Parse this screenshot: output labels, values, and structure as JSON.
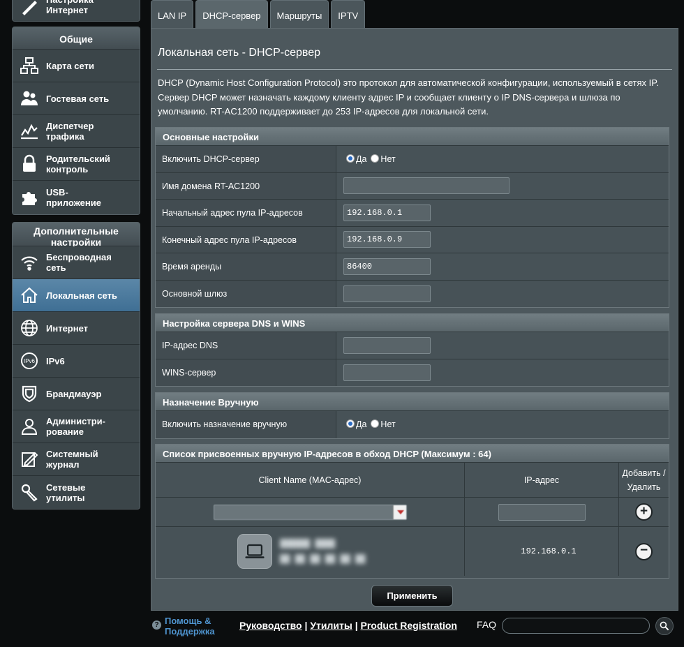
{
  "sidebar": {
    "top_item": "Настройка\nИнтернет",
    "general": {
      "title": "Общие",
      "items": [
        {
          "label": "Карта сети",
          "icon": "network-map-icon"
        },
        {
          "label": "Гостевая сеть",
          "icon": "guest-network-icon"
        },
        {
          "label": "Диспетчер\nтрафика",
          "icon": "traffic-manager-icon"
        },
        {
          "label": "Родительский\nконтроль",
          "icon": "lock-icon"
        },
        {
          "label": "USB-\nприложение",
          "icon": "puzzle-icon"
        }
      ]
    },
    "advanced": {
      "title": "Дополнительные\nнастройки",
      "items": [
        {
          "label": "Беспроводная\nсеть",
          "icon": "wifi-icon"
        },
        {
          "label": "Локальная сеть",
          "icon": "home-icon",
          "active": true
        },
        {
          "label": "Интернет",
          "icon": "globe-icon"
        },
        {
          "label": "IPv6",
          "icon": "ipv6-icon"
        },
        {
          "label": "Брандмауэр",
          "icon": "shield-icon"
        },
        {
          "label": "Администри-\nрование",
          "icon": "admin-user-icon"
        },
        {
          "label": "Системный\nжурнал",
          "icon": "system-log-icon"
        },
        {
          "label": "Сетевые\nутилиты",
          "icon": "tools-icon"
        }
      ]
    }
  },
  "tabs": [
    "LAN IP",
    "DHCP-сервер",
    "Маршруты",
    "IPTV"
  ],
  "active_tab": 1,
  "page": {
    "title": "Локальная сеть - DHCP-сервер",
    "description": "DHCP (Dynamic Host Configuration Protocol) это протокол для автоматической конфигурации, используемый в сетях IP. Сервер DHCP может назначать каждому клиенту адрес IP и сообщает клиенту о IP DNS-сервера и шлюза по умолчанию. RT-AC1200 поддерживает до 253 IP-адресов для локальной сети."
  },
  "basic": {
    "title": "Основные настройки",
    "enable_label": "Включить DHCP-сервер",
    "yes": "Да",
    "no": "Нет",
    "domain_label": "Имя домена RT-AC1200",
    "domain_value": "",
    "start_label": "Начальный адрес пула IP-адресов",
    "start_value": "192.168.0.1",
    "end_label": "Конечный адрес пула IP-адресов",
    "end_value": "192.168.0.9",
    "lease_label": "Время аренды",
    "lease_value": "86400",
    "gateway_label": "Основной шлюз",
    "gateway_value": ""
  },
  "dns": {
    "title": "Настройка сервера DNS и WINS",
    "dns_label": "IP-адрес DNS",
    "dns_value": "",
    "wins_label": "WINS-сервер",
    "wins_value": ""
  },
  "manual": {
    "title": "Назначение Вручную",
    "enable_label": "Включить назначение вручную",
    "yes": "Да",
    "no": "Нет"
  },
  "list": {
    "title": "Список присвоенных вручную IP-адресов в обход DHCP (Максимум : 64)",
    "col_client": "Client Name (MAC-адрес)",
    "col_ip": "IP-адрес",
    "col_action": "Добавить /\nУдалить",
    "select_value": "",
    "ip_input_value": "",
    "entries": [
      {
        "ip": "192.168.0.1"
      }
    ]
  },
  "apply_label": "Применить",
  "footer": {
    "help": "Помощь &\nПоддержка",
    "link1": "Руководство",
    "link2": "Утилиты",
    "link3": "Product Registration",
    "sep": "|",
    "faq": "FAQ"
  }
}
